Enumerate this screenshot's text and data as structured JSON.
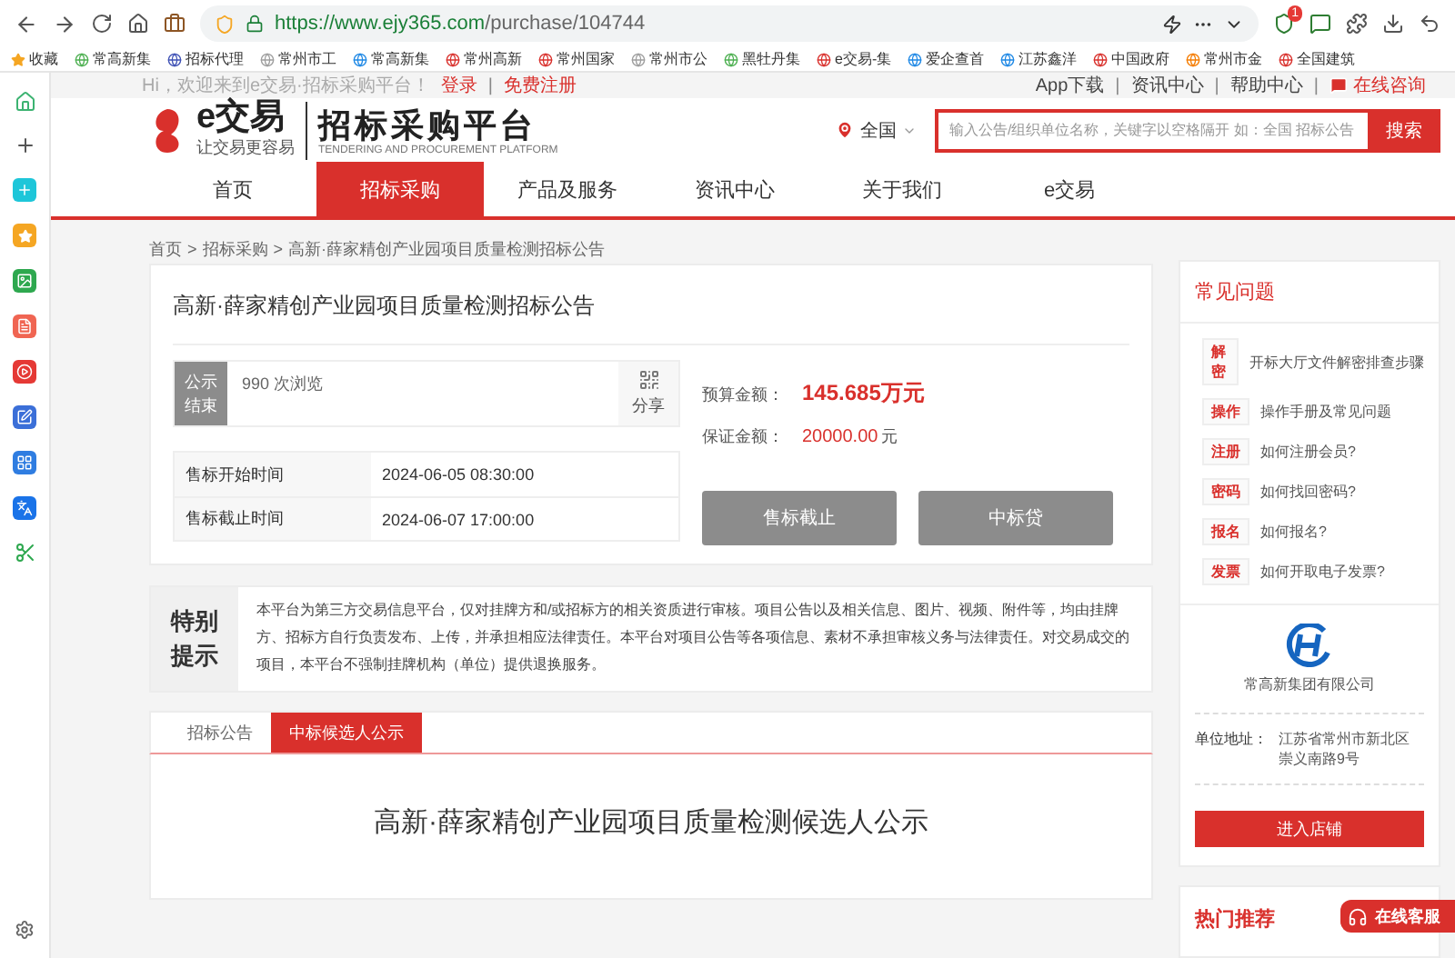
{
  "browser": {
    "url_host": "https://www.ejy365.com",
    "url_path": "/purchase/104744",
    "badge": "1"
  },
  "bookmarks": [
    "收藏",
    "常高新集",
    "招标代理",
    "常州市工",
    "常高新集",
    "常州高新",
    "常州国家",
    "常州市公",
    "黑牡丹集",
    "e交易-集",
    "爱企查首",
    "江苏鑫洋",
    "中国政府",
    "常州市金",
    "全国建筑"
  ],
  "topbar": {
    "separator": "|",
    "greeting": "Hi，欢迎来到e交易·招标采购平台！",
    "login": "登录",
    "register": "免费注册",
    "links": [
      "App下载",
      "资讯中心",
      "帮助中心"
    ],
    "consult": "在线咨询"
  },
  "header": {
    "logo_brand": "e交易",
    "logo_slogan": "让交易更容易",
    "platform_title": "招标采购平台",
    "platform_subtitle": "TENDERING AND PROCUREMENT PLATFORM",
    "region": "全国",
    "search_placeholder": "输入公告/组织单位名称，关键字以空格隔开 如：全国 招标公告",
    "search_button": "搜索"
  },
  "nav": [
    {
      "label": "首页",
      "selected": false
    },
    {
      "label": "招标采购",
      "selected": true
    },
    {
      "label": "产品及服务",
      "selected": false
    },
    {
      "label": "资讯中心",
      "selected": false
    },
    {
      "label": "关于我们",
      "selected": false
    },
    {
      "label": "e交易",
      "selected": false
    }
  ],
  "breadcrumb": {
    "separator": ">",
    "items": [
      "首页",
      "招标采购",
      "高新·薛家精创产业园项目质量检测招标公告"
    ]
  },
  "notice": {
    "title": "高新·薛家精创产业园项目质量检测招标公告",
    "status": "公示结束",
    "views": "990 次浏览",
    "share": "分享",
    "schedule": [
      {
        "label": "售标开始时间",
        "value": "2024-06-05 08:30:00"
      },
      {
        "label": "售标截止时间",
        "value": "2024-06-07 17:00:00"
      }
    ],
    "budget_label": "预算金额：",
    "budget_value": "145.685万元",
    "deposit_label": "保证金额：",
    "deposit_value": "20000.00",
    "deposit_unit": "元",
    "buttons": [
      "售标截止",
      "中标贷"
    ]
  },
  "special_notice": {
    "heading": "特别提示",
    "text": "本平台为第三方交易信息平台，仅对挂牌方和/或招标方的相关资质进行审核。项目公告以及相关信息、图片、视频、附件等，均由挂牌方、招标方自行负责发布、上传，并承担相应法律责任。本平台对项目公告等各项信息、素材不承担审核义务与法律责任。对交易成交的项目，本平台不强制挂牌机构（单位）提供退换服务。"
  },
  "tabs": [
    {
      "label": "招标公告",
      "selected": false
    },
    {
      "label": "中标候选人公示",
      "selected": true
    }
  ],
  "announcement_title": "高新·薛家精创产业园项目质量检测候选人公示",
  "faq": {
    "title": "常见问题",
    "items": [
      {
        "tag": "解密",
        "text": "开标大厅文件解密排查步骤"
      },
      {
        "tag": "操作",
        "text": "操作手册及常见问题"
      },
      {
        "tag": "注册",
        "text": "如何注册会员?"
      },
      {
        "tag": "密码",
        "text": "如何找回密码?"
      },
      {
        "tag": "报名",
        "text": "如何报名?"
      },
      {
        "tag": "发票",
        "text": "如何开取电子发票?"
      }
    ]
  },
  "company": {
    "name": "常高新集团有限公司",
    "address_label": "单位地址：",
    "address": "江苏省常州市新北区崇义南路9号",
    "button": "进入店铺"
  },
  "hot": {
    "title": "热门推荐"
  },
  "chat_button": "在线客服"
}
